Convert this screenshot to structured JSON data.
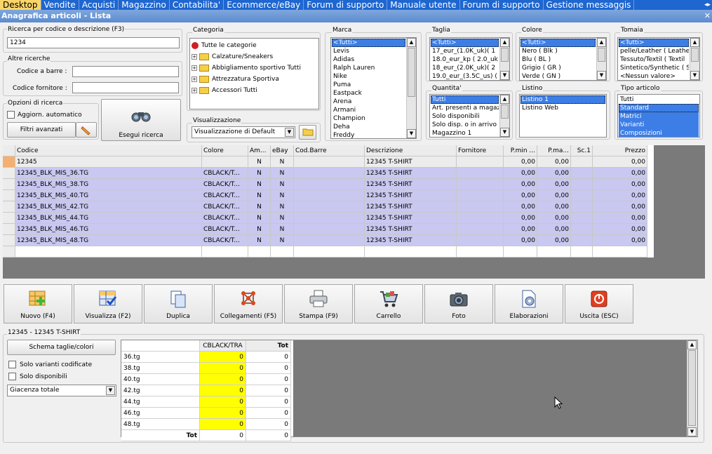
{
  "menu": {
    "items": [
      "Desktop",
      "Vendite",
      "Acquisti",
      "Magazzino",
      "Contabilita'",
      "Ecommerce/eBay",
      "Forum di supporto",
      "Manuale utente",
      "Forum di supporto",
      "Gestione messaggis"
    ]
  },
  "window": {
    "title": "Anagrafica articoli  - Lista"
  },
  "search": {
    "legend": "Ricerca per codice o descrizione (F3)",
    "value": "1234"
  },
  "other": {
    "legend": "Altre ricerche",
    "barcode_label": "Codice a barre :",
    "supplier_label": "Codice fornitore :"
  },
  "options": {
    "legend": "Opzioni di ricerca",
    "auto_update": "Aggiorn. automatico",
    "advanced": "Filtri avanzati",
    "run": "Esegui ricerca"
  },
  "category": {
    "legend": "Categoria",
    "items": [
      "Tutte le categorie",
      "Calzature/Sneakers",
      "Abbigliamento sportivo Tutti",
      "Attrezzatura Sportiva",
      "Accessori Tutti"
    ]
  },
  "view": {
    "legend": "Visualizzazione",
    "value": "Visualizzazione di Default"
  },
  "brand": {
    "legend": "Marca",
    "items": [
      "<Tutti>",
      "Levis",
      "Adidas",
      "Ralph Lauren",
      "Nike",
      "Puma",
      "Eastpack",
      "Arena",
      "Armani",
      "Champion",
      "Deha",
      "Freddy"
    ]
  },
  "size": {
    "legend": "Taglia",
    "items": [
      "<Tutti>",
      "17_eur_(1.0K_uk)( 1",
      "18.0_eur_kp ( 2.0_uk",
      "18_eur_(2.0K_uk)( 2",
      "19.0_eur_(3.5C_us) ("
    ]
  },
  "color": {
    "legend": "Colore",
    "items": [
      "<Tutti>",
      "Nero ( Blk )",
      "Blu ( BL )",
      "Grigio ( GR )",
      "Verde ( GN )"
    ]
  },
  "upper": {
    "legend": "Tomaia",
    "items": [
      "<Tutti>",
      "pelle/Leather ( Leather",
      "Tessuto/Textil ( Textil",
      "Sintetico/Synthetic ( S",
      "<Nessun valore>"
    ]
  },
  "qty": {
    "legend": "Quantita'",
    "items": [
      "Tutti",
      "Art. presenti a magaz",
      "Solo disponibili",
      "Solo disp. o in arrivo",
      "Magazzino 1"
    ]
  },
  "pricelist": {
    "legend": "Listino",
    "items": [
      "Listino 1",
      "Listino Web"
    ]
  },
  "type": {
    "legend": "Tipo articolo",
    "items": [
      "Tutti",
      "Standard",
      "Matrici",
      "Varianti",
      "Composizioni"
    ]
  },
  "table": {
    "headers": [
      "Codice",
      "Colore",
      "Am...",
      "eBay",
      "Cod.Barre",
      "Descrizione",
      "Fornitore",
      "P.min ...",
      "P.ma...",
      "Sc.1",
      "Prezzo"
    ],
    "rows": [
      [
        "12345",
        "",
        "N",
        "N",
        "",
        "12345  T-SHIRT",
        "",
        "0,00",
        "0,00",
        "",
        "0,00"
      ],
      [
        "12345_BLK_MIS_36.TG",
        "CBLACK/T...",
        "N",
        "N",
        "",
        "12345  T-SHIRT",
        "",
        "0,00",
        "0,00",
        "",
        "0,00"
      ],
      [
        "12345_BLK_MIS_38.TG",
        "CBLACK/T...",
        "N",
        "N",
        "",
        "12345  T-SHIRT",
        "",
        "0,00",
        "0,00",
        "",
        "0,00"
      ],
      [
        "12345_BLK_MIS_40.TG",
        "CBLACK/T...",
        "N",
        "N",
        "",
        "12345  T-SHIRT",
        "",
        "0,00",
        "0,00",
        "",
        "0,00"
      ],
      [
        "12345_BLK_MIS_42.TG",
        "CBLACK/T...",
        "N",
        "N",
        "",
        "12345  T-SHIRT",
        "",
        "0,00",
        "0,00",
        "",
        "0,00"
      ],
      [
        "12345_BLK_MIS_44.TG",
        "CBLACK/T...",
        "N",
        "N",
        "",
        "12345  T-SHIRT",
        "",
        "0,00",
        "0,00",
        "",
        "0,00"
      ],
      [
        "12345_BLK_MIS_46.TG",
        "CBLACK/T...",
        "N",
        "N",
        "",
        "12345  T-SHIRT",
        "",
        "0,00",
        "0,00",
        "",
        "0,00"
      ],
      [
        "12345_BLK_MIS_48.TG",
        "CBLACK/T...",
        "N",
        "N",
        "",
        "12345  T-SHIRT",
        "",
        "0,00",
        "0,00",
        "",
        "0,00"
      ]
    ]
  },
  "toolbar": {
    "new": "Nuovo (F4)",
    "view": "Visualizza (F2)",
    "dup": "Duplica",
    "links": "Collegamenti (F5)",
    "print": "Stampa (F9)",
    "cart": "Carrello",
    "photo": "Foto",
    "proc": "Elaborazioni",
    "exit": "Uscita (ESC)"
  },
  "detail": {
    "legend": "12345 - 12345  T-SHIRT",
    "scheme": "Schema taglie/colori",
    "only_coded": "Solo varianti codificate",
    "only_avail": "Solo disponibili",
    "stock": "Giacenza totale",
    "col_color": "CBLACK/TRA",
    "col_tot": "Tot",
    "rows": [
      [
        "36.tg",
        "0",
        "0"
      ],
      [
        "38.tg",
        "0",
        "0"
      ],
      [
        "40.tg",
        "0",
        "0"
      ],
      [
        "42.tg",
        "0",
        "0"
      ],
      [
        "44.tg",
        "0",
        "0"
      ],
      [
        "46.tg",
        "0",
        "0"
      ],
      [
        "48.tg",
        "0",
        "0"
      ]
    ],
    "total_label": "Tot",
    "total_color": "0",
    "total_tot": "0"
  }
}
